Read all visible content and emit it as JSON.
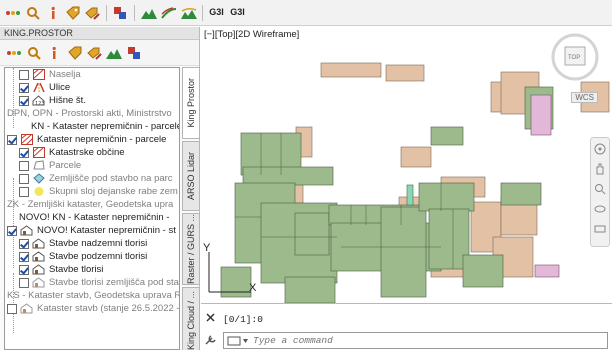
{
  "toolbar": {
    "label_1": "G3I",
    "label_2": "G3I",
    "icons": [
      "dots-icon",
      "search-icon",
      "info-icon",
      "tag-icon",
      "tag-edit-icon",
      "layers-icon",
      "terrain-icon",
      "stream-icon",
      "terrain-2-icon",
      "g3i-icon",
      "g3i-2-icon"
    ]
  },
  "palette": {
    "title": "KING.PROSTOR",
    "tree": [
      {
        "label": "Naselja",
        "checked": false,
        "grey": true
      },
      {
        "label": "Ulice",
        "checked": true,
        "grey": false
      },
      {
        "label": "Hišne št.",
        "checked": true,
        "grey": false
      },
      {
        "label": "DPN, OPN - Prostorski akti, Ministrstvo",
        "grey": true
      },
      {
        "label": "KN - Kataster nepremičnin - parcele,",
        "grey": false
      },
      {
        "label": "Kataster nepremičnin - parcele",
        "checked": true,
        "grey": false
      },
      {
        "label": "Katastrske občine",
        "checked": true,
        "grey": false
      },
      {
        "label": "Parcele",
        "checked": false,
        "grey": true
      },
      {
        "label": "Zemljišče pod stavbo na parc",
        "checked": false,
        "grey": true
      },
      {
        "label": "Skupni sloj dejanske rabe zem",
        "checked": false,
        "grey": true
      },
      {
        "label": "ZK - Zemljiški kataster, Geodetska upra",
        "grey": true
      },
      {
        "label": "NOVO! KN - Kataster nepremičnin -",
        "grey": false
      },
      {
        "label": "NOVO! Kataster nepremičnin - st",
        "checked": true,
        "grey": false
      },
      {
        "label": "Stavbe nadzemni tlorisi",
        "checked": true,
        "grey": false
      },
      {
        "label": "Stavbe podzemni tlorisi",
        "checked": true,
        "grey": false
      },
      {
        "label": "Stavbe tlorisi",
        "checked": true,
        "grey": false
      },
      {
        "label": "Stavbe tlorisi zemljišča pod stav",
        "checked": false,
        "grey": true
      },
      {
        "label": "KS - Kataster stavb, Geodetska uprava R",
        "grey": true
      },
      {
        "label": "Kataster stavb (stanje 26.5.2022 -",
        "checked": false,
        "grey": true
      }
    ],
    "tabs": [
      "King Prostor",
      "ARSO Lidar",
      "Raster / GURS ...",
      "King Cloud / ..."
    ]
  },
  "drawing": {
    "view_label": "[−][Top][2D Wireframe]",
    "wcs_label": "WCS",
    "view_cube_label": "TOP",
    "axis_y": "Y",
    "axis_x": "X",
    "colors": {
      "green": "#9dba8d",
      "tan": "#e3c1a4",
      "pink": "#e2b7d8",
      "teal": "#8ed6b3"
    }
  },
  "command": {
    "history": "[0/1]:0",
    "placeholder": "Type a command"
  }
}
